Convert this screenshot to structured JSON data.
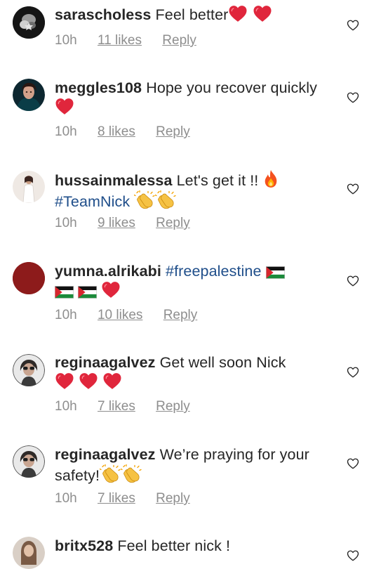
{
  "comments": [
    {
      "username": "sarascholess",
      "text": "Feel better",
      "emoji_after": [
        "red-heart",
        "red-heart"
      ],
      "time": "10h",
      "likes": "11 likes",
      "reply": "Reply"
    },
    {
      "username": "meggles108",
      "text": "Hope you recover quickly",
      "emoji_after": [
        "red-heart"
      ],
      "time": "10h",
      "likes": "8 likes",
      "reply": "Reply"
    },
    {
      "username": "hussainmalessa",
      "text": "Let's get it !!",
      "hashtag": "#TeamNick",
      "emoji_after": [
        "fire",
        "clapping-hands",
        "clapping-hands"
      ],
      "time": "10h",
      "likes": "9 likes",
      "reply": "Reply"
    },
    {
      "username": "yumna.alrikabi",
      "hashtag": "#freepalestine",
      "emoji_after": [
        "palestine-flag",
        "palestine-flag",
        "palestine-flag",
        "red-heart"
      ],
      "time": "10h",
      "likes": "10 likes",
      "reply": "Reply"
    },
    {
      "username": "reginaagalvez",
      "text": "Get well soon Nick",
      "emoji_after": [
        "red-heart",
        "red-heart",
        "red-heart"
      ],
      "time": "10h",
      "likes": "7 likes",
      "reply": "Reply"
    },
    {
      "username": "reginaagalvez",
      "text": "We’re praying for your safety!",
      "emoji_after": [
        "clapping-hands",
        "clapping-hands"
      ],
      "time": "10h",
      "likes": "7 likes",
      "reply": "Reply"
    },
    {
      "username": "britx528",
      "text": "Feel better nick !"
    }
  ],
  "colors": {
    "username": "#262626",
    "text": "#262626",
    "meta": "#8e8e8e",
    "hashtag": "#1f4e8a",
    "heart": "#e0263c"
  },
  "icons": {
    "like": "heart-outline-icon"
  }
}
